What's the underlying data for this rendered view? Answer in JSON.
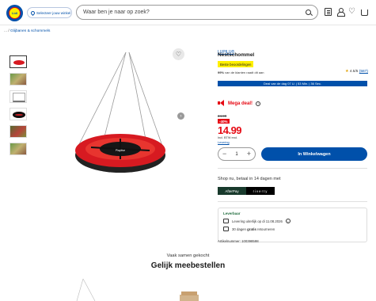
{
  "header": {
    "logo_text": "Lidl",
    "store_button": "Selecteer jouw winkel",
    "search_placeholder": "Waar ben je naar op zoek?"
  },
  "breadcrumb": {
    "ellipsis": "...",
    "separator": "/",
    "current": "Glijbanen & schommels"
  },
  "product": {
    "brand": "LUPILU®",
    "title": "Nestschommel",
    "badge": "Beste beoordelingen",
    "recommend_pct": "99%",
    "recommend_text": "van de klanten raadt dit aan",
    "rating": "4.5/5",
    "review_count": "(587)",
    "deal_text": "Deal van de dag 07 U. | 53 Min. | 36 Sec.",
    "mega_deal": "Mega deal!",
    "old_price": "24.99",
    "discount": "-40%",
    "price": "14.99",
    "vat_text": "Incl. BTW excl.",
    "delivery_cost_link": "Levering",
    "quantity": "1",
    "add_to_cart": "In Winkelwagen",
    "paylater_text": "Shop nu, betaal in 14 dagen met",
    "afterpay": "AfterPay",
    "riverty": "riverty",
    "delivery_title": "Leverbaar",
    "delivery_line1": "Levering uiterlijk op di 11.08.2026",
    "delivery_line2_pre": "30 dagen",
    "delivery_line2_bold": "gratis",
    "delivery_line2_post": "retourneren",
    "article_number": "Artikelnummer: 100398598"
  },
  "recommendations": {
    "subtitle": "Vaak samen gekocht",
    "title": "Gelijk meebestellen"
  },
  "colors": {
    "brand_blue": "#0050aa",
    "deal_red": "#e60a14",
    "badge_yellow": "#fff000"
  }
}
